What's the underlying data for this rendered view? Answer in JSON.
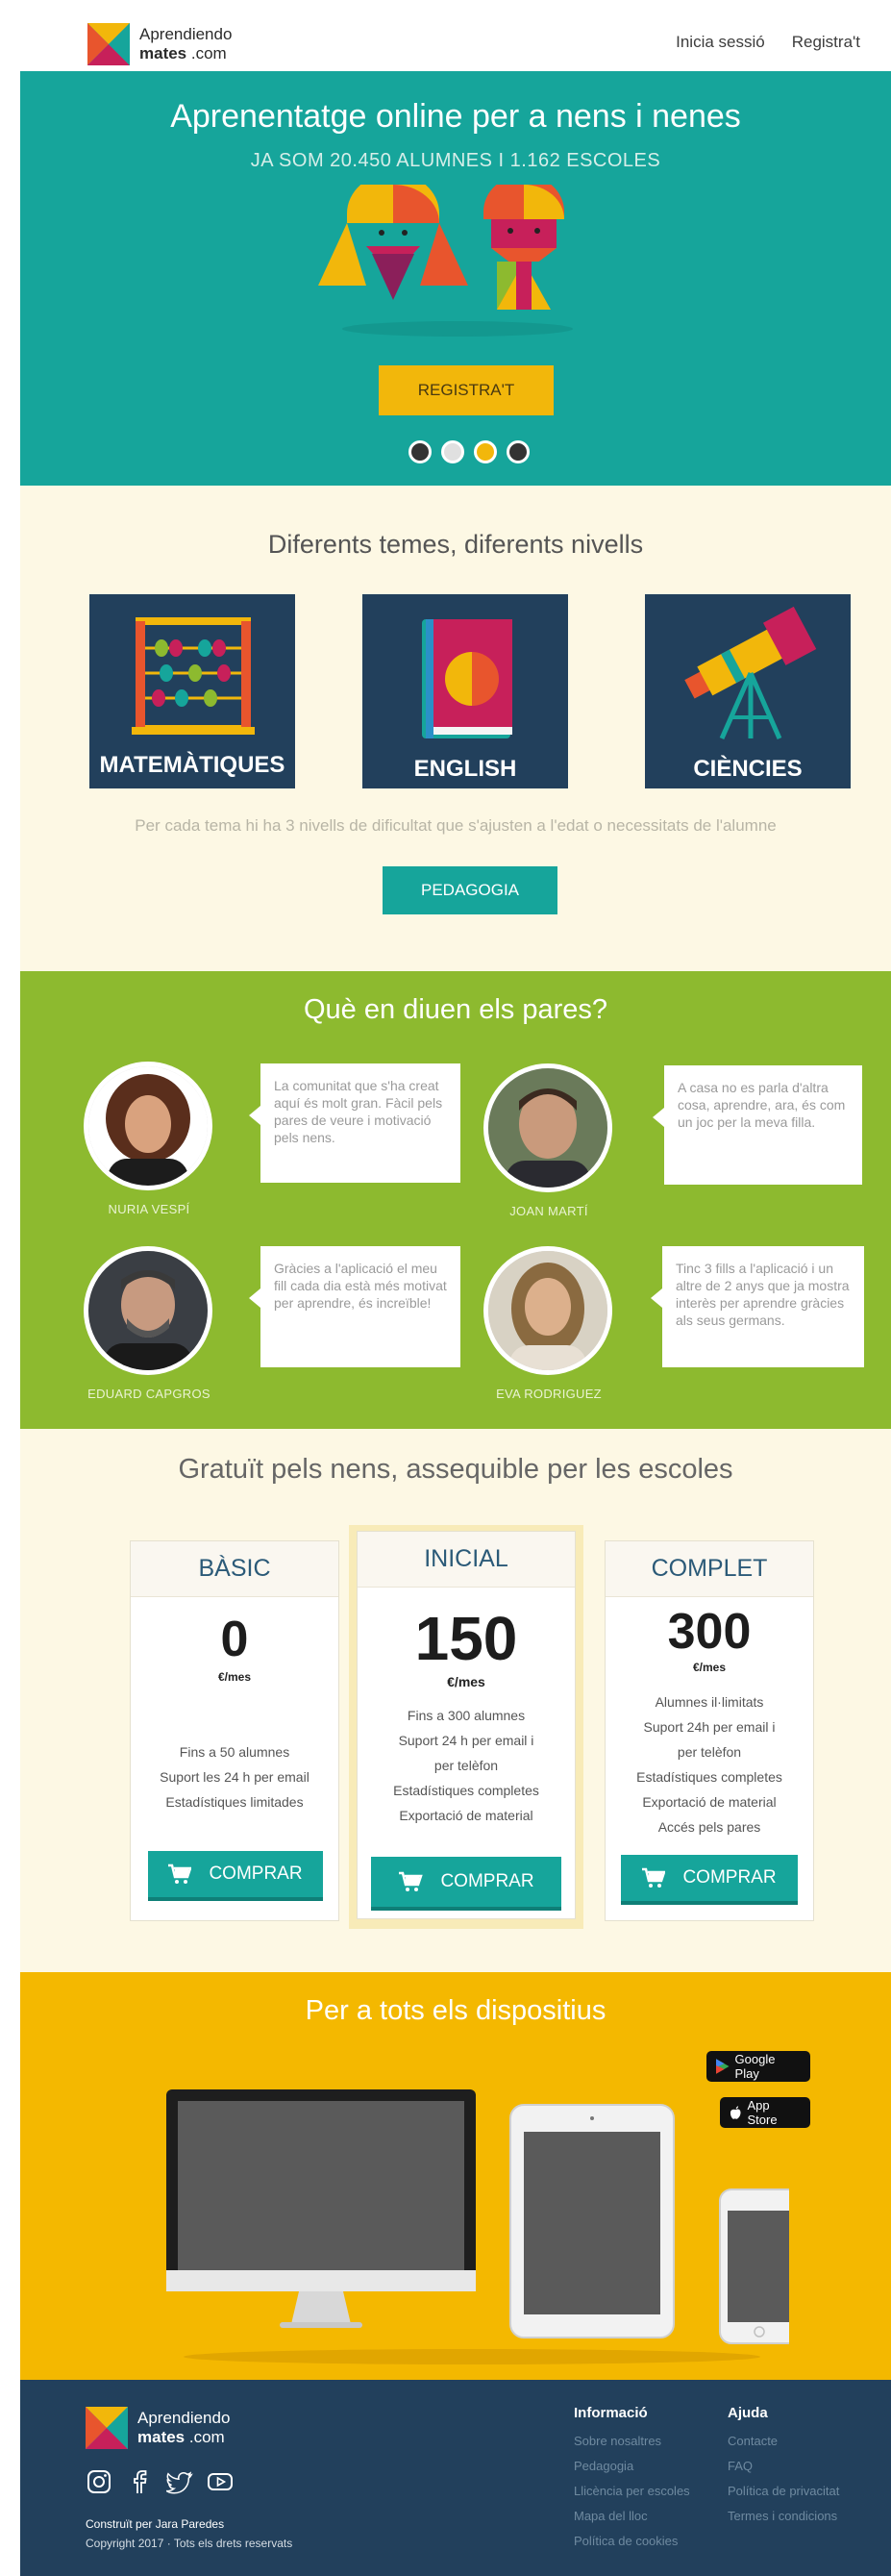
{
  "brand": {
    "line1": "Aprendiendo",
    "line2_bold": "mates",
    "line2_rest": " .com"
  },
  "nav": {
    "login": "Inicia sessió",
    "register": "Registra't"
  },
  "hero": {
    "title": "Aprenentatge online per a nens i nenes",
    "subtitle": "JA SOM 20.450 ALUMNES I 1.162 ESCOLES",
    "cta": "REGISTRA'T",
    "slides": 4,
    "active_slide": 3
  },
  "topics": {
    "title": "Diferents temes, diferents nivells",
    "items": [
      {
        "label": "MATEMÀTIQUES",
        "icon": "abacus-icon"
      },
      {
        "label": "ENGLISH",
        "icon": "book-icon"
      },
      {
        "label": "CIÈNCIES",
        "icon": "telescope-icon"
      }
    ],
    "description": "Per cada tema hi ha 3 nivells de dificultat que s'ajusten a l'edat o necessitats de l'alumne",
    "cta": "PEDAGOGIA"
  },
  "parents": {
    "title": "Què en diuen els pares?",
    "items": [
      {
        "name": "NURIA VESPÍ",
        "quote": "La comunitat que s'ha creat aquí és molt gran. Fàcil pels pares de veure i motivació pels nens."
      },
      {
        "name": "JOAN MARTÍ",
        "quote": "A casa no es parla d'altra cosa, aprendre, ara, és com un joc per la meva filla."
      },
      {
        "name": "EDUARD CAPGROS",
        "quote": "Gràcies a l'aplicació el meu fill cada dia està més motivat per aprendre, és increïble!"
      },
      {
        "name": "EVA RODRIGUEZ",
        "quote": "Tinc 3 fills a l'aplicació i un altre de 2 anys que ja mostra interès per aprendre gràcies als seus germans."
      }
    ]
  },
  "pricing": {
    "title": "Gratuït pels nens, assequible per les escoles",
    "buy_label": "COMPRAR",
    "plans": [
      {
        "name": "BÀSIC",
        "price": "0",
        "unit": "€/mes",
        "features": [
          "Fins a 50 alumnes",
          "Suport les 24 h per email",
          "Estadístiques limitades"
        ]
      },
      {
        "name": "INICIAL",
        "price": "150",
        "unit": "€/mes",
        "features": [
          "Fins a 300 alumnes",
          "Suport 24 h per email i",
          "per telèfon",
          "Estadístiques completes",
          "Exportació de material"
        ]
      },
      {
        "name": "COMPLET",
        "price": "300",
        "unit": "€/mes",
        "features": [
          "Alumnes il·limitats",
          "Suport 24h per email i",
          "per telèfon",
          "Estadístiques completes",
          "Exportació de material",
          "Accés pels pares"
        ]
      }
    ]
  },
  "devices": {
    "title": "Per a tots els dispositius",
    "google_play": "Google Play",
    "app_store": "App Store"
  },
  "footer": {
    "credit": "Construït per Jara Paredes",
    "copyright": "Copyright 2017 · Tots els drets reservats",
    "info_title": "Informació",
    "info_links": [
      "Sobre nosaltres",
      "Pedagogia",
      "Llicència per escoles",
      "Mapa del lloc",
      "Política de cookies"
    ],
    "help_title": "Ajuda",
    "help_links": [
      "Contacte",
      "FAQ",
      "Política de privacitat",
      "Termes i condicions"
    ]
  },
  "colors": {
    "teal": "#16a59b",
    "yellow": "#f2b70b",
    "green": "#8dba2f",
    "navy": "#22405c",
    "cream": "#fdf8e4"
  }
}
